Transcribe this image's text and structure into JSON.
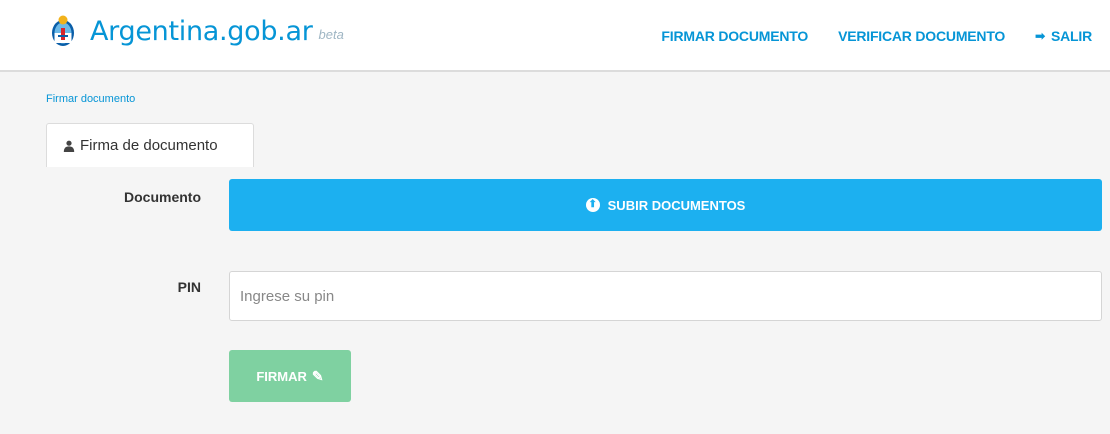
{
  "header": {
    "brand_name": "Argentina.gob.ar",
    "brand_tag": "beta",
    "brand_color": "#0695d6",
    "logo_icon": "argentina-seal-icon",
    "nav": [
      {
        "label": "FIRMAR DOCUMENTO"
      },
      {
        "label": "VERIFICAR DOCUMENTO"
      },
      {
        "label": "SALIR",
        "icon": "exit-icon"
      }
    ]
  },
  "breadcrumb": {
    "label": "Firmar documento"
  },
  "tabs": [
    {
      "label": "Firma de documento",
      "icon": "user-icon",
      "active": true
    }
  ],
  "form": {
    "document_label": "Documento",
    "upload_button": {
      "label": "SUBIR DOCUMENTOS",
      "icon": "upload-icon",
      "color": "#1cb0f0"
    },
    "pin_label": "PIN",
    "pin_input": {
      "value": "",
      "placeholder": "Ingrese su pin"
    },
    "sign_button": {
      "label": "FIRMAR",
      "icon": "pencil-icon",
      "color": "#7fd1a1"
    }
  }
}
